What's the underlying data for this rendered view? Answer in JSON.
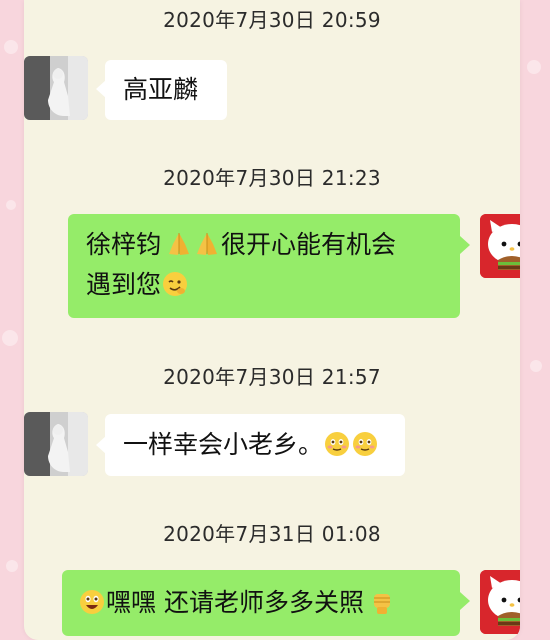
{
  "messages": [
    {
      "timestamp": "2020年7月30日 20:59",
      "sender": "left",
      "text": "高亚麟"
    },
    {
      "timestamp": "2020年7月30日 21:23",
      "sender": "right",
      "line1": "徐梓钧",
      "line1_after": "很开心能有机会",
      "line2": "遇到您",
      "emojis": [
        "folded-hands-icon",
        "folded-hands-icon",
        "winking-face-icon"
      ]
    },
    {
      "timestamp": "2020年7月30日 21:57",
      "sender": "left",
      "text": "一样幸会小老乡。",
      "emojis": [
        "blushing-smile-icon",
        "blushing-smile-icon"
      ]
    },
    {
      "timestamp": "2020年7月31日 01:08",
      "sender": "right",
      "text_a": "嘿嘿",
      "text_b": "还请老师多多关照",
      "emojis": [
        "grinning-face-icon",
        "raised-fist-icon"
      ]
    }
  ],
  "colors": {
    "page_background": "#f8d6dd",
    "chat_background": "#f6f3e2",
    "bubble_incoming": "#ffffff",
    "bubble_outgoing": "#95ec69"
  }
}
